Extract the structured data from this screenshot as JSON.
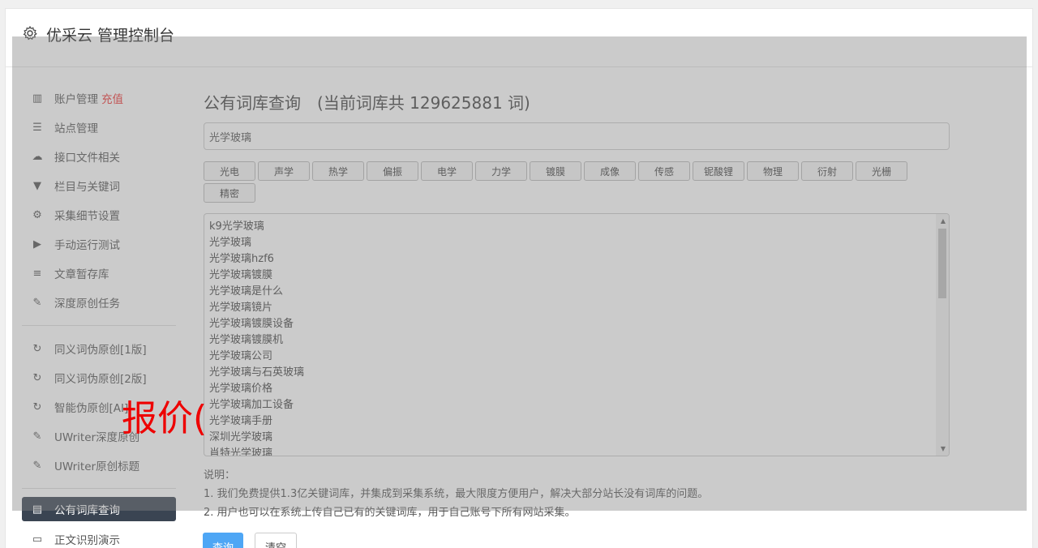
{
  "app": {
    "title": "优采云 管理控制台"
  },
  "sidebar": {
    "items": [
      {
        "label": "账户管理",
        "badge": "充值",
        "icon": "bar-chart-icon"
      },
      {
        "label": "站点管理",
        "icon": "server-icon"
      },
      {
        "label": "接口文件相关",
        "icon": "cloud-upload-icon"
      },
      {
        "label": "栏目与关键词",
        "icon": "filter-icon"
      },
      {
        "label": "采集细节设置",
        "icon": "gears-icon"
      },
      {
        "label": "手动运行测试",
        "icon": "play-circle-icon"
      },
      {
        "label": "文章暂存库",
        "icon": "database-icon"
      },
      {
        "label": "深度原创任务",
        "icon": "edit-icon"
      }
    ],
    "items2": [
      {
        "label": "同义词伪原创[1版]",
        "icon": "refresh-icon"
      },
      {
        "label": "同义词伪原创[2版]",
        "icon": "refresh-icon"
      },
      {
        "label": "智能伪原创[AI]",
        "icon": "refresh-icon"
      },
      {
        "label": "UWriter深度原创",
        "icon": "edit-icon"
      },
      {
        "label": "UWriter原创标题",
        "icon": "edit-icon"
      }
    ],
    "items3": [
      {
        "label": "公有词库查询",
        "icon": "book-icon",
        "active": true
      },
      {
        "label": "正文识别演示",
        "icon": "monitor-icon"
      }
    ]
  },
  "main": {
    "heading": "公有词库查询",
    "count_text": "(当前词库共 129625881 词)",
    "search_value": "光学玻璃",
    "tags": [
      "光电",
      "声学",
      "热学",
      "偏振",
      "电学",
      "力学",
      "镀膜",
      "成像",
      "传感",
      "铌酸锂",
      "物理",
      "衍射",
      "光栅",
      "精密"
    ],
    "results": [
      "k9光学玻璃",
      "光学玻璃",
      "光学玻璃hzf6",
      "光学玻璃镀膜",
      "光学玻璃是什么",
      "光学玻璃镜片",
      "光学玻璃镀膜设备",
      "光学玻璃镀膜机",
      "光学玻璃公司",
      "光学玻璃与石英玻璃",
      "光学玻璃价格",
      "光学玻璃加工设备",
      "光学玻璃手册",
      "深圳光学玻璃",
      "肖特光学玻璃"
    ],
    "notes_title": "说明：",
    "notes": [
      "1. 我们免费提供1.3亿关键词库，并集成到采集系统，最大限度方便用户，解决大部分站长没有词库的问题。",
      "2. 用户也可以在系统上传自己已有的关键词库，用于自己账号下所有网站采集。"
    ],
    "query_button": "查询",
    "clear_button": "清空"
  },
  "watermark": "报价("
}
